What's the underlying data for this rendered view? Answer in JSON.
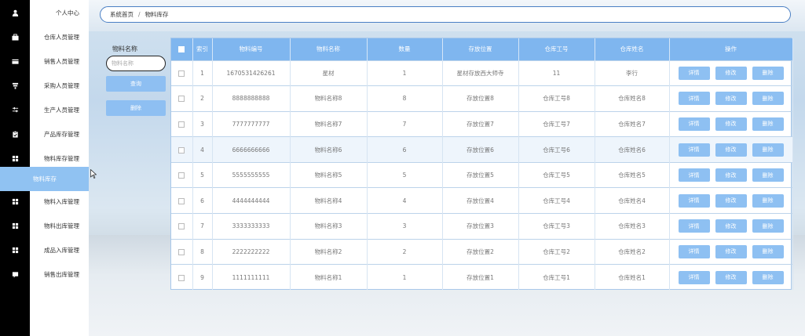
{
  "sidebar": {
    "items": [
      {
        "label": "个人中心",
        "icon": "user-icon"
      },
      {
        "label": "仓库人员管理",
        "icon": "briefcase-icon"
      },
      {
        "label": "销售人员管理",
        "icon": "card-icon"
      },
      {
        "label": "采购人员管理",
        "icon": "funnel-icon"
      },
      {
        "label": "生产人员管理",
        "icon": "sliders-icon"
      },
      {
        "label": "产品库存管理",
        "icon": "clipboard-icon"
      },
      {
        "label": "物料库存管理",
        "icon": "grid-icon"
      },
      {
        "label": "物料库存",
        "icon": "",
        "active": true
      },
      {
        "label": "物料入库管理",
        "icon": "grid-icon"
      },
      {
        "label": "物料出库管理",
        "icon": "grid-icon"
      },
      {
        "label": "成品入库管理",
        "icon": "grid-icon"
      },
      {
        "label": "销售出库管理",
        "icon": "chat-icon"
      }
    ]
  },
  "breadcrumb": {
    "home": "系统首页",
    "separator": "/",
    "current": "物料库存"
  },
  "search": {
    "label": "物料名称",
    "placeholder": "物料名称",
    "query_button": "查询",
    "delete_button": "删除"
  },
  "table": {
    "headers": [
      "索引",
      "物料编号",
      "物料名称",
      "数量",
      "存放位置",
      "仓库工号",
      "仓库姓名",
      "操作"
    ],
    "action_labels": {
      "detail": "详情",
      "edit": "修改",
      "delete": "删除"
    },
    "rows": [
      {
        "index": "1",
        "code": "1670531426261",
        "name": "星材",
        "qty": "1",
        "location": "星材存放西大师寺",
        "wh_id": "11",
        "wh_name": "李行"
      },
      {
        "index": "2",
        "code": "8888888888",
        "name": "物料名称8",
        "qty": "8",
        "location": "存放位置8",
        "wh_id": "仓库工号8",
        "wh_name": "仓库姓名8"
      },
      {
        "index": "3",
        "code": "7777777777",
        "name": "物料名称7",
        "qty": "7",
        "location": "存放位置7",
        "wh_id": "仓库工号7",
        "wh_name": "仓库姓名7"
      },
      {
        "index": "4",
        "code": "6666666666",
        "name": "物料名称6",
        "qty": "6",
        "location": "存放位置6",
        "wh_id": "仓库工号6",
        "wh_name": "仓库姓名6"
      },
      {
        "index": "5",
        "code": "5555555555",
        "name": "物料名称5",
        "qty": "5",
        "location": "存放位置5",
        "wh_id": "仓库工号5",
        "wh_name": "仓库姓名5"
      },
      {
        "index": "6",
        "code": "4444444444",
        "name": "物料名称4",
        "qty": "4",
        "location": "存放位置4",
        "wh_id": "仓库工号4",
        "wh_name": "仓库姓名4"
      },
      {
        "index": "7",
        "code": "3333333333",
        "name": "物料名称3",
        "qty": "3",
        "location": "存放位置3",
        "wh_id": "仓库工号3",
        "wh_name": "仓库姓名3"
      },
      {
        "index": "8",
        "code": "2222222222",
        "name": "物料名称2",
        "qty": "2",
        "location": "存放位置2",
        "wh_id": "仓库工号2",
        "wh_name": "仓库姓名2"
      },
      {
        "index": "9",
        "code": "1111111111",
        "name": "物料名称1",
        "qty": "1",
        "location": "存放位置1",
        "wh_id": "仓库工号1",
        "wh_name": "仓库姓名1"
      }
    ]
  },
  "colors": {
    "accent": "#7fb6ef",
    "button": "#8ec0f2",
    "rail": "#000000",
    "active_menu": "#90c2f2"
  }
}
